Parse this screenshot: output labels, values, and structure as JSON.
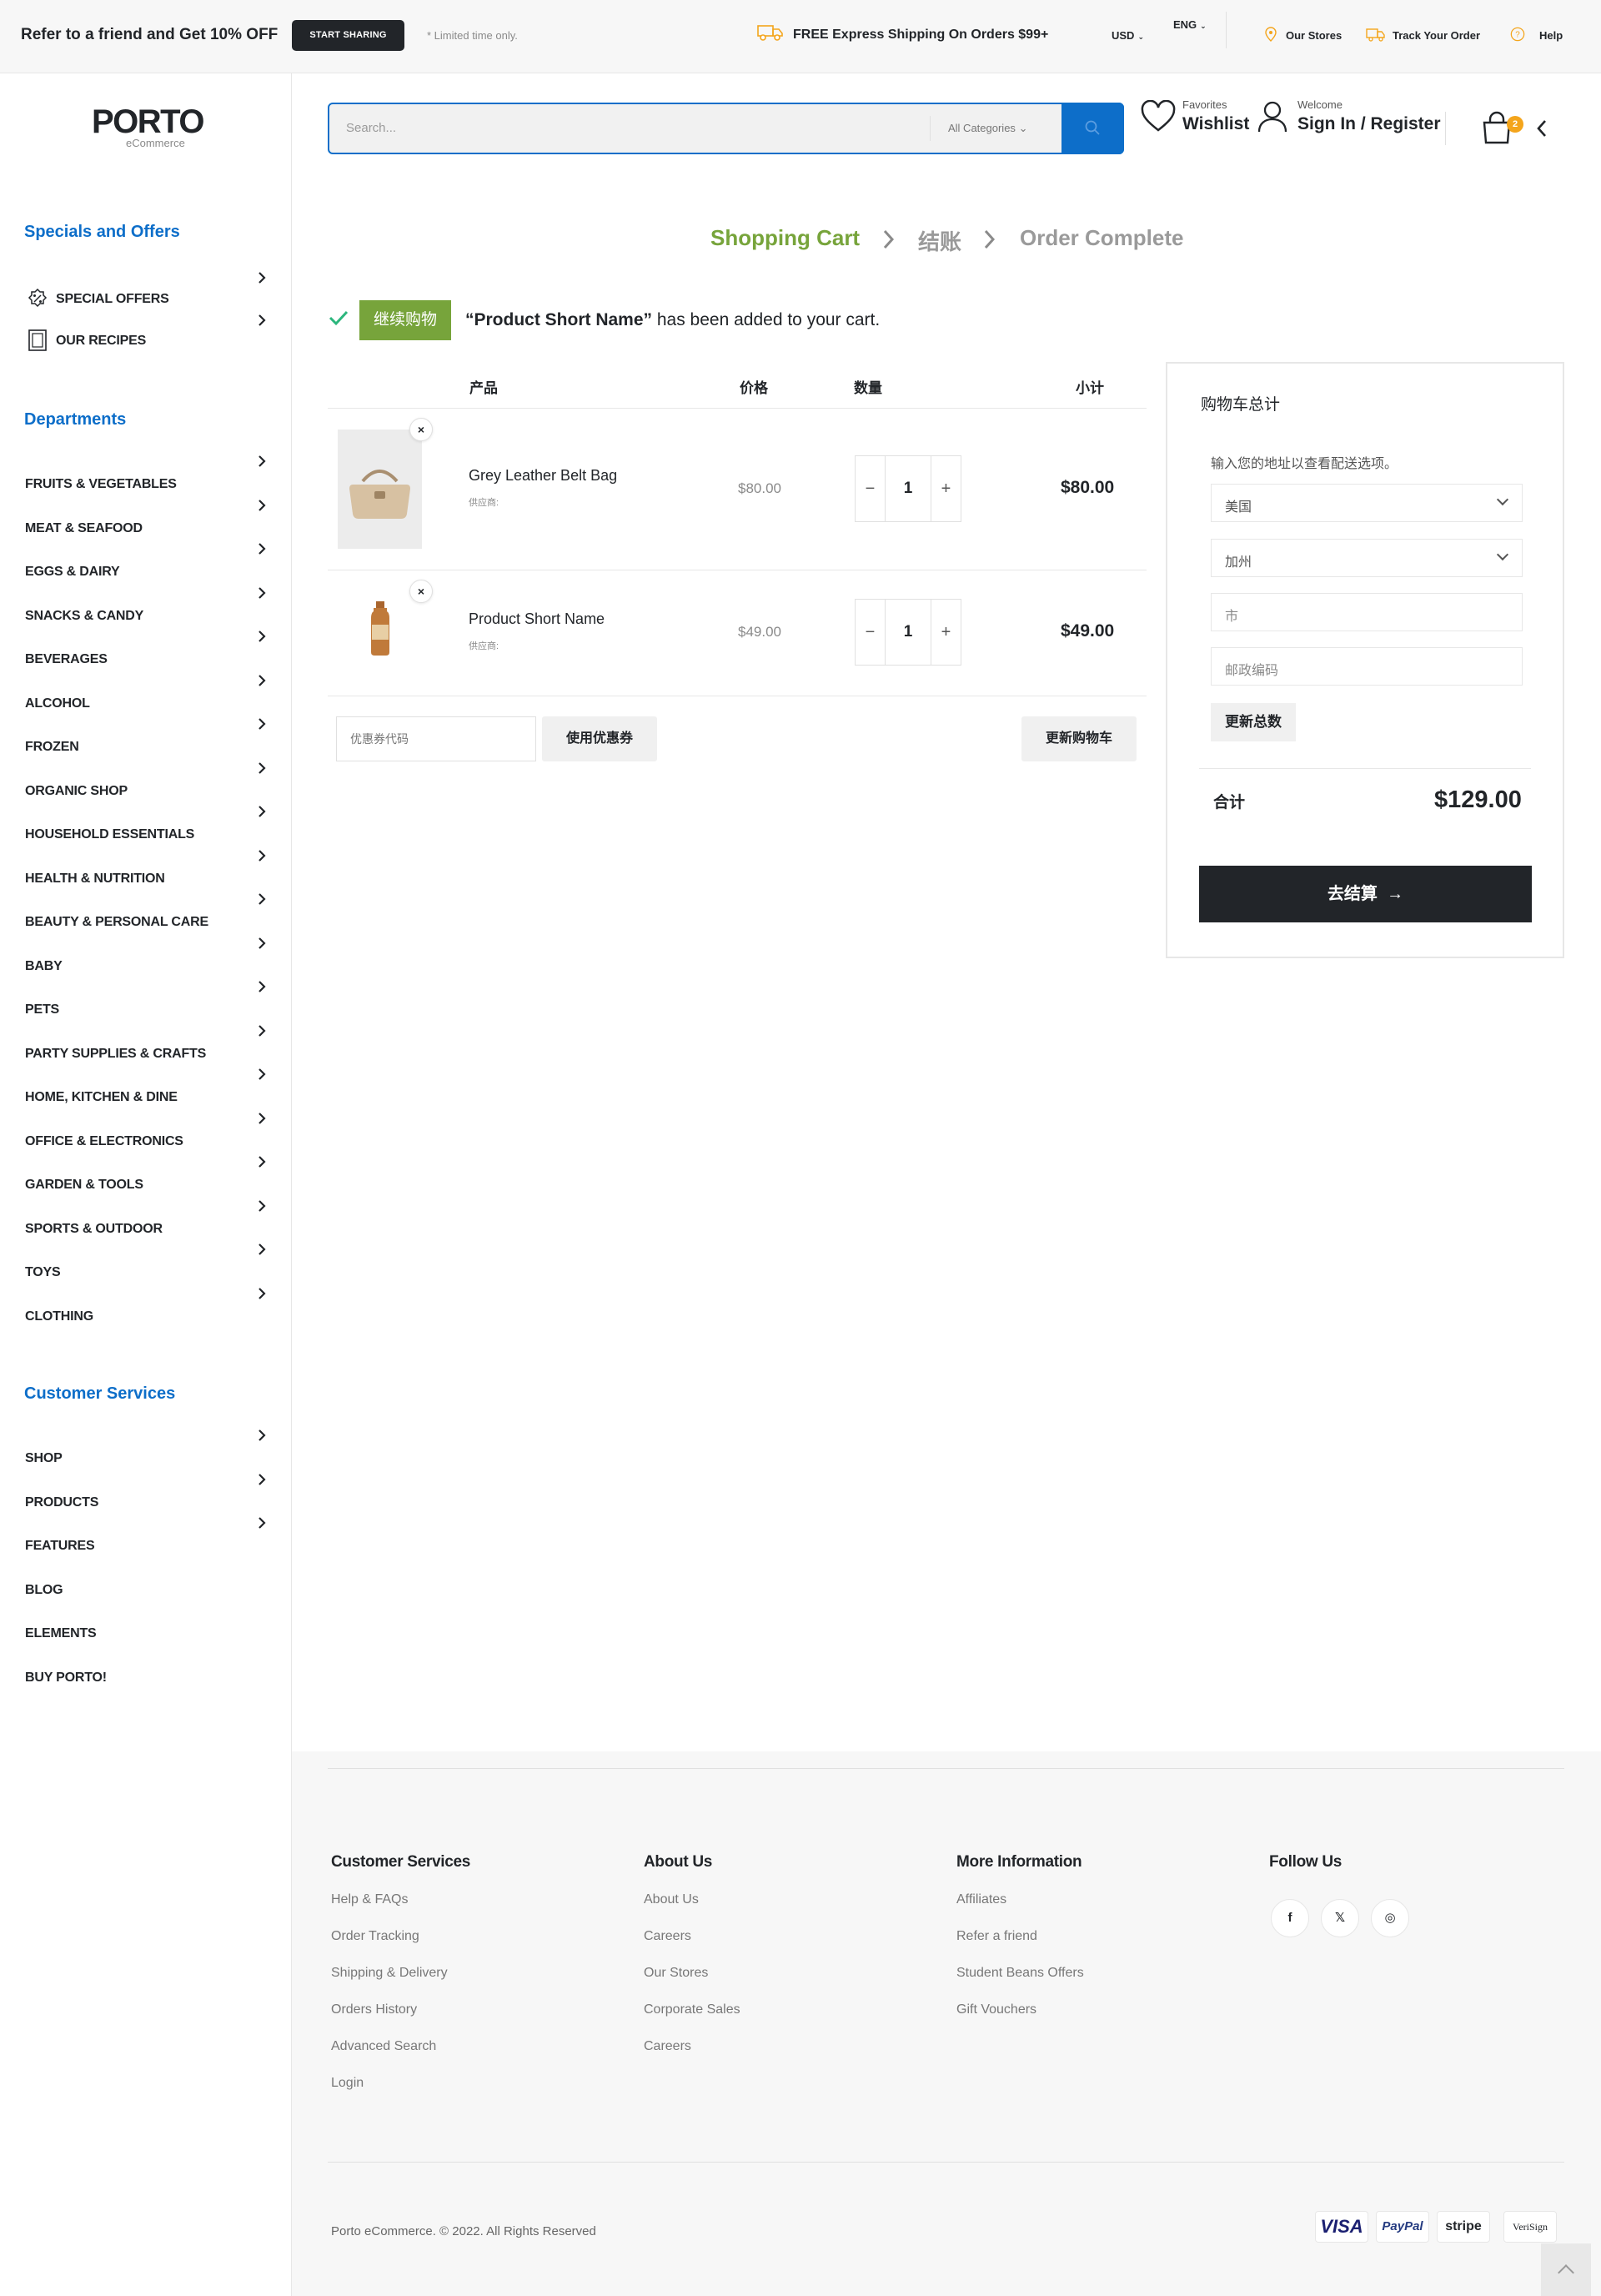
{
  "topbar": {
    "refer_text": "Refer to a friend and Get 10% OFF",
    "share_button": "START SHARING",
    "limited": "* Limited time only.",
    "shipping": "FREE Express Shipping On Orders $99+",
    "currency": "USD",
    "language": "ENG",
    "links": [
      "Our Stores",
      "Track Your Order",
      "Help"
    ]
  },
  "logo": {
    "brand": "PORTO",
    "sub": "eCommerce"
  },
  "header": {
    "search_placeholder": "Search...",
    "category": "All Categories",
    "wishlist_small": "Favorites",
    "wishlist_big": "Wishlist",
    "account_small": "Welcome",
    "account_big": "Sign In / Register",
    "cart_count": "2"
  },
  "sidebar": {
    "specials_title": "Specials and Offers",
    "specials": [
      "SPECIAL OFFERS",
      "OUR RECIPES"
    ],
    "departments_title": "Departments",
    "departments": [
      "FRUITS & VEGETABLES",
      "MEAT & SEAFOOD",
      "EGGS & DAIRY",
      "SNACKS & CANDY",
      "BEVERAGES",
      "ALCOHOL",
      "FROZEN",
      "ORGANIC SHOP",
      "HOUSEHOLD ESSENTIALS",
      "HEALTH & NUTRITION",
      "BEAUTY & PERSONAL CARE",
      "BABY",
      "PETS",
      "PARTY SUPPLIES & CRAFTS",
      "HOME, KITCHEN & DINE",
      "OFFICE & ELECTRONICS",
      "GARDEN & TOOLS",
      "SPORTS & OUTDOOR",
      "TOYS",
      "CLOTHING"
    ],
    "services_title": "Customer Services",
    "services": [
      "SHOP",
      "PRODUCTS",
      "FEATURES",
      "BLOG",
      "ELEMENTS",
      "BUY PORTO!"
    ]
  },
  "steps": [
    "Shopping Cart",
    "结账",
    "Order Complete"
  ],
  "message": {
    "button": "继续购物",
    "product": "“Product Short Name”",
    "text": " has been added to your cart."
  },
  "cart": {
    "headers": {
      "product": "产品",
      "price": "价格",
      "quantity": "数量",
      "subtotal": "小计"
    },
    "items": [
      {
        "name": "Grey Leather Belt Bag",
        "vendor": "供应商:",
        "price": "$80.00",
        "qty": "1",
        "subtotal": "$80.00"
      },
      {
        "name": "Product Short Name",
        "vendor": "供应商:",
        "price": "$49.00",
        "qty": "1",
        "subtotal": "$49.00"
      }
    ],
    "coupon_placeholder": "优惠券代码",
    "apply_coupon": "使用优惠券",
    "update_cart": "更新购物车"
  },
  "totals": {
    "title": "购物车总计",
    "shipping_note": "输入您的地址以查看配送选项。",
    "country": "美国",
    "state": "加州",
    "city_placeholder": "市",
    "zip_placeholder": "邮政编码",
    "update_totals": "更新总数",
    "total_label": "合计",
    "total_value": "$129.00",
    "checkout": "去结算"
  },
  "footer": {
    "columns": [
      {
        "title": "Customer Services",
        "links": [
          "Help & FAQs",
          "Order Tracking",
          "Shipping & Delivery",
          "Orders History",
          "Advanced Search",
          "Login"
        ]
      },
      {
        "title": "About Us",
        "links": [
          "About Us",
          "Careers",
          "Our Stores",
          "Corporate Sales",
          "Careers"
        ]
      },
      {
        "title": "More Information",
        "links": [
          "Affiliates",
          "Refer a friend",
          "Student Beans Offers",
          "Gift Vouchers"
        ]
      },
      {
        "title": "Follow Us",
        "links": []
      }
    ],
    "social": [
      "f",
      "𝕏",
      "◎"
    ],
    "copyright": "Porto eCommerce. © 2022. All Rights Reserved",
    "payments": [
      "VISA",
      "PayPal",
      "stripe",
      "VeriSign"
    ]
  },
  "colors": {
    "accent_blue": "#0d6ec9",
    "accent_green": "#77a43b",
    "dark": "#222529",
    "badge": "#f4a51c"
  }
}
